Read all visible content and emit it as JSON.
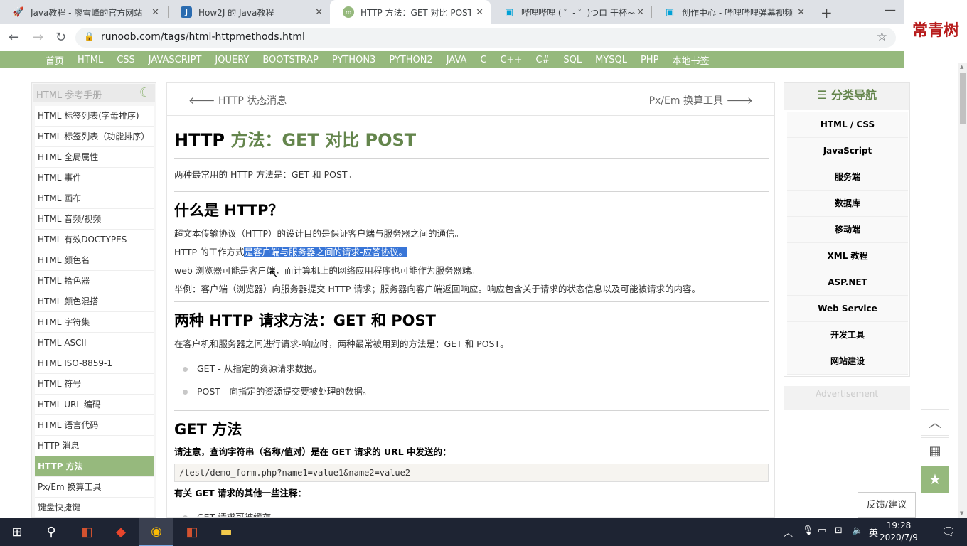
{
  "browser": {
    "tabs": [
      {
        "title": "Java教程 - 廖雪峰的官方网站",
        "icon": "rocket-icon"
      },
      {
        "title": "How2J 的 Java教程",
        "icon": "j-icon"
      },
      {
        "title": "HTTP 方法：GET 对比 POST |",
        "icon": "runoob-icon"
      },
      {
        "title": "哔哩哔哩 ( ゜- ゜)つロ 干杯~-b",
        "icon": "bilibili-icon"
      },
      {
        "title": "创作中心 - 哔哩哔哩弹幕视频",
        "icon": "bilibili-icon"
      }
    ],
    "url": "runoob.com/tags/html-httpmethods.html",
    "logo_text": "常青树"
  },
  "site_nav": [
    "首页",
    "HTML",
    "CSS",
    "JAVASCRIPT",
    "JQUERY",
    "BOOTSTRAP",
    "PYTHON3",
    "PYTHON2",
    "JAVA",
    "C",
    "C++",
    "C#",
    "SQL",
    "MYSQL",
    "PHP",
    "本地书签"
  ],
  "left_sidebar": {
    "search_placeholder": "HTML 参考手册",
    "items": [
      "HTML 标签列表(字母排序)",
      "HTML 标签列表（功能排序）",
      "HTML 全局属性",
      "HTML 事件",
      "HTML 画布",
      "HTML 音频/视频",
      "HTML 有效DOCTYPES",
      "HTML 颜色名",
      "HTML 拾色器",
      "HTML 颜色混搭",
      "HTML 字符集",
      "HTML ASCII",
      "HTML ISO-8859-1",
      "HTML 符号",
      "HTML URL 编码",
      "HTML 语言代码",
      "HTTP 消息",
      "HTTP 方法",
      "Px/Em 换算工具",
      "键盘快捷键"
    ],
    "active_index": 17
  },
  "main": {
    "prev_link": "HTTP 状态消息",
    "next_link": "Px/Em 换算工具",
    "title_black": "HTTP ",
    "title_green": "方法：GET 对比 POST",
    "intro": "两种最常用的 HTTP 方法是：GET 和 POST。",
    "h2_what": "什么是 HTTP？",
    "p1": "超文本传输协议（HTTP）的设计目的是保证客户端与服务器之间的通信。",
    "p2_prefix": "HTTP 的工作方式",
    "p2_highlight": "是客户端与服务器之间的请求-应答协议。",
    "p3": "web 浏览器可能是客户端，而计算机上的网络应用程序也可能作为服务器端。",
    "p4": "举例：客户端（浏览器）向服务器提交 HTTP 请求；服务器向客户端返回响应。响应包含关于请求的状态信息以及可能被请求的内容。",
    "h2_two": "两种 HTTP 请求方法：GET 和 POST",
    "p5": "在客户机和服务器之间进行请求-响应时，两种最常被用到的方法是：GET 和 POST。",
    "methods": [
      {
        "name": "GET",
        "desc": " - 从指定的资源请求数据。"
      },
      {
        "name": "POST",
        "desc": " - 向指定的资源提交要被处理的数据。"
      }
    ],
    "h2_get": "GET 方法",
    "get_note": "请注意，查询字符串（名称/值对）是在 GET 请求的 URL 中发送的：",
    "code": "/test/demo_form.php?name1=value1&name2=value2",
    "get_other": "有关 GET 请求的其他一些注释：",
    "get_items": [
      "GET 请求可被缓存"
    ]
  },
  "right_sidebar": {
    "title": "分类导航",
    "items": [
      "HTML / CSS",
      "JavaScript",
      "服务端",
      "数据库",
      "移动端",
      "XML 教程",
      "ASP.NET",
      "Web Service",
      "开发工具",
      "网站建设"
    ],
    "ad_label": "Advertisement"
  },
  "feedback_label": "反馈/建议",
  "taskbar": {
    "ime": "英",
    "time": "19:28",
    "date": "2020/7/9"
  }
}
